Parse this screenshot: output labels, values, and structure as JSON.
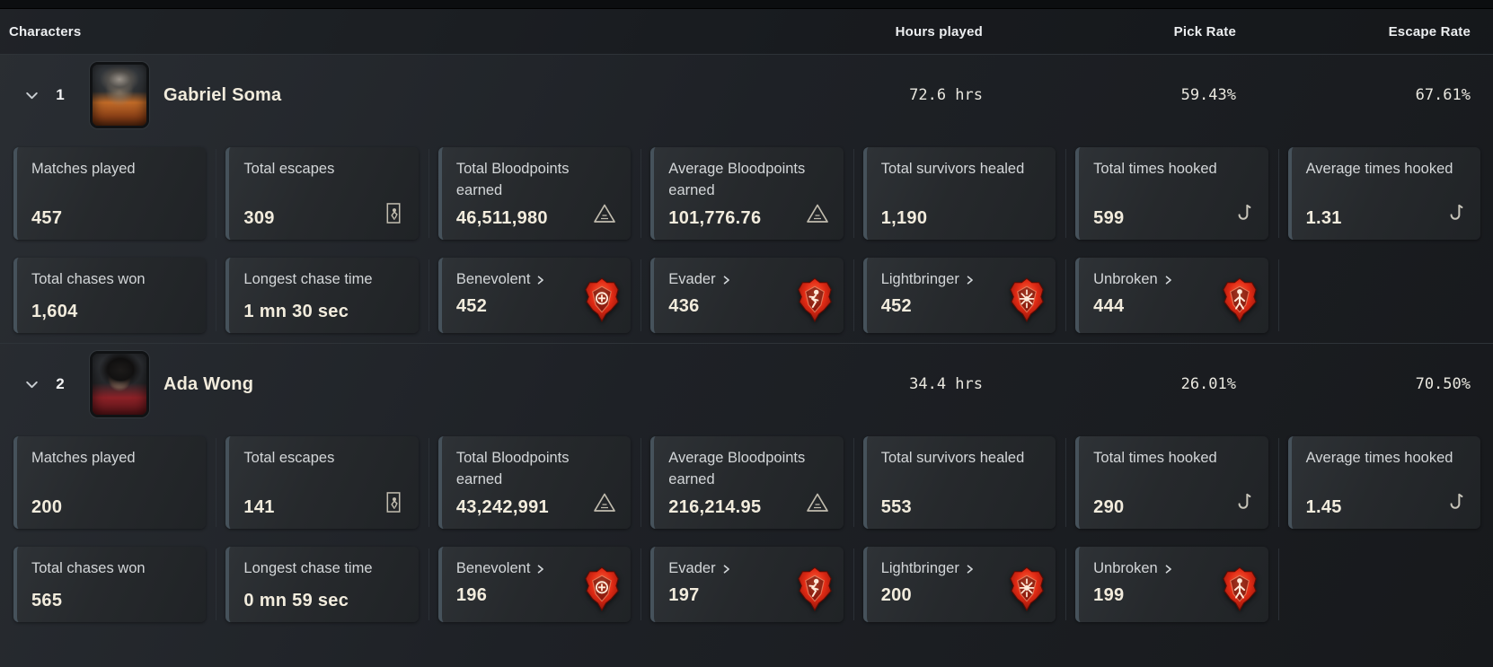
{
  "header": {
    "characters": "Characters",
    "hours_played": "Hours played",
    "pick_rate": "Pick Rate",
    "escape_rate": "Escape Rate"
  },
  "colors": {
    "card_accent": "#46525b",
    "emblem_red": "#e02a14",
    "value_text": "#f2ecdd",
    "background": "#1e2126"
  },
  "characters": [
    {
      "rank": "1",
      "name": "Gabriel Soma",
      "avatar": "gabriel-portrait",
      "hours_played": "72.6 hrs",
      "pick_rate": "59.43%",
      "escape_rate": "67.61%",
      "cards_row1": [
        {
          "label": "Matches played",
          "value": "457",
          "icon": "none"
        },
        {
          "label": "Total escapes",
          "value": "309",
          "icon": "escape-door-icon"
        },
        {
          "label": "Total Bloodpoints earned",
          "value": "46,511,980",
          "icon": "bloodpoints-icon"
        },
        {
          "label": "Average Bloodpoints earned",
          "value": "101,776.76",
          "icon": "bloodpoints-icon"
        },
        {
          "label": "Total survivors healed",
          "value": "1,190",
          "icon": "none"
        },
        {
          "label": "Total times hooked",
          "value": "599",
          "icon": "hook-icon"
        },
        {
          "label": "Average times hooked",
          "value": "1.31",
          "icon": "hook-icon"
        }
      ],
      "cards_row2": [
        {
          "label": "Total chases won",
          "value": "1,604",
          "icon": "none"
        },
        {
          "label": "Longest chase time",
          "value": "1 mn 30 sec",
          "icon": "none"
        },
        {
          "label": "Benevolent",
          "value": "452",
          "icon": "benevolent-emblem-icon",
          "link": true
        },
        {
          "label": "Evader",
          "value": "436",
          "icon": "evader-emblem-icon",
          "link": true
        },
        {
          "label": "Lightbringer",
          "value": "452",
          "icon": "lightbringer-emblem-icon",
          "link": true
        },
        {
          "label": "Unbroken",
          "value": "444",
          "icon": "unbroken-emblem-icon",
          "link": true
        }
      ]
    },
    {
      "rank": "2",
      "name": "Ada Wong",
      "avatar": "ada-portrait",
      "hours_played": "34.4 hrs",
      "pick_rate": "26.01%",
      "escape_rate": "70.50%",
      "cards_row1": [
        {
          "label": "Matches played",
          "value": "200",
          "icon": "none"
        },
        {
          "label": "Total escapes",
          "value": "141",
          "icon": "escape-door-icon"
        },
        {
          "label": "Total Bloodpoints earned",
          "value": "43,242,991",
          "icon": "bloodpoints-icon"
        },
        {
          "label": "Average Bloodpoints earned",
          "value": "216,214.95",
          "icon": "bloodpoints-icon"
        },
        {
          "label": "Total survivors healed",
          "value": "553",
          "icon": "none"
        },
        {
          "label": "Total times hooked",
          "value": "290",
          "icon": "hook-icon"
        },
        {
          "label": "Average times hooked",
          "value": "1.45",
          "icon": "hook-icon"
        }
      ],
      "cards_row2": [
        {
          "label": "Total chases won",
          "value": "565",
          "icon": "none"
        },
        {
          "label": "Longest chase time",
          "value": "0 mn 59 sec",
          "icon": "none"
        },
        {
          "label": "Benevolent",
          "value": "196",
          "icon": "benevolent-emblem-icon",
          "link": true
        },
        {
          "label": "Evader",
          "value": "197",
          "icon": "evader-emblem-icon",
          "link": true
        },
        {
          "label": "Lightbringer",
          "value": "200",
          "icon": "lightbringer-emblem-icon",
          "link": true
        },
        {
          "label": "Unbroken",
          "value": "199",
          "icon": "unbroken-emblem-icon",
          "link": true
        }
      ]
    }
  ]
}
